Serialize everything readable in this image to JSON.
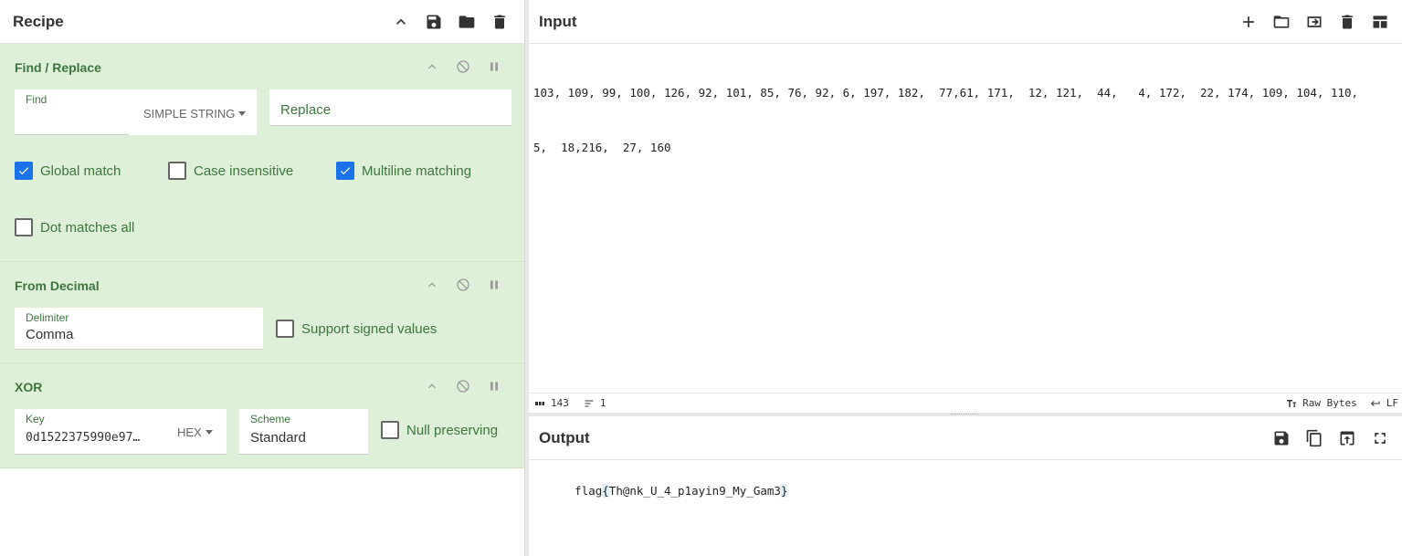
{
  "recipe": {
    "title": "Recipe",
    "icons": [
      "chevron-up-icon",
      "save-icon",
      "folder-icon",
      "trash-icon"
    ],
    "operations": [
      {
        "title": "Find / Replace",
        "find_label": "Find",
        "find_value": "",
        "find_type": "SIMPLE STRING",
        "replace_placeholder": "Replace",
        "global_match": "Global match",
        "case_insensitive": "Case insensitive",
        "multiline": "Multiline matching",
        "dot_matches_all": "Dot matches all"
      },
      {
        "title": "From Decimal",
        "delimiter_label": "Delimiter",
        "delimiter_value": "Comma",
        "signed": "Support signed values"
      },
      {
        "title": "XOR",
        "key_label": "Key",
        "key_value": "0d1522375990e97…",
        "key_type": "HEX",
        "scheme_label": "Scheme",
        "scheme_value": "Standard",
        "null_preserving": "Null preserving"
      }
    ]
  },
  "input": {
    "title": "Input",
    "line1": "103, 109, 99, 100, 126, 92, 101, 85, 76, 92, 6, 197, 182,  77,61, 171,  12, 121,  44,   4, 172,  22, 174, 109, 104, 110,",
    "line2": "5,  18,216,  27, 160",
    "status": {
      "chars": "143",
      "lines": "1",
      "format": "Raw Bytes",
      "eol": "LF"
    }
  },
  "output": {
    "title": "Output",
    "prefix": "flag",
    "open_brace": "{",
    "body": "Th@nk_U_4_p1ayin9_My_Gam3",
    "close_brace": "}"
  }
}
